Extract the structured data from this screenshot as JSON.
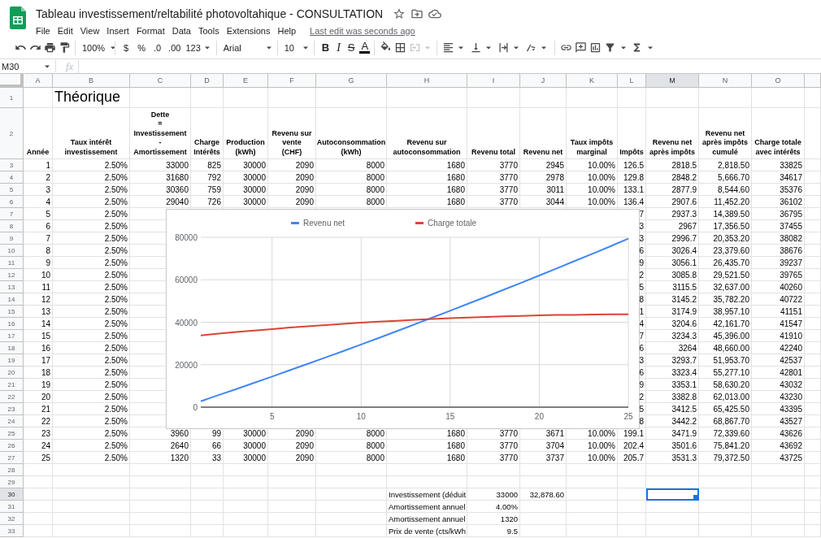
{
  "app": {
    "title": "Tableau investissement/reltabilité photovoltahique - CONSULTATION",
    "menus": [
      "File",
      "Edit",
      "View",
      "Insert",
      "Format",
      "Data",
      "Tools",
      "Extensions",
      "Help"
    ],
    "last_edit": "Last edit was seconds ago"
  },
  "toolbar": {
    "zoom": "100%",
    "currency": "$",
    "percent": "%",
    "decrease_decimals": ".0",
    "increase_decimals": ".00",
    "number_format": "123",
    "font": "Arial",
    "font_size": "10",
    "bold": "B",
    "italic": "I",
    "strikethrough": "S",
    "text_color": "A"
  },
  "formula_bar": {
    "name_box": "M30",
    "fx": "fx"
  },
  "sheet": {
    "columns": [
      {
        "label": "A",
        "selected": false
      },
      {
        "label": "B",
        "selected": false
      },
      {
        "label": "C",
        "selected": false
      },
      {
        "label": "D",
        "selected": false
      },
      {
        "label": "E",
        "selected": false
      },
      {
        "label": "F",
        "selected": false
      },
      {
        "label": "G",
        "selected": false
      },
      {
        "label": "H",
        "selected": false
      },
      {
        "label": "I",
        "selected": false
      },
      {
        "label": "J",
        "selected": false
      },
      {
        "label": "K",
        "selected": false
      },
      {
        "label": "L",
        "selected": false
      },
      {
        "label": "M",
        "selected": true
      },
      {
        "label": "N",
        "selected": false
      },
      {
        "label": "O",
        "selected": false
      }
    ],
    "rows": [
      {
        "header": "1",
        "selected": false,
        "kind": "title",
        "cells": [
          null,
          "Théorique"
        ]
      },
      {
        "header": "2",
        "selected": false,
        "kind": "header",
        "cells": [
          "Année",
          "Taux intérêt\ninvestissement",
          "Dette\n=\nInvestissement\n-\nAmortissement",
          "Charge\nIntérêts",
          "Production\n(kWh)",
          "Revenu sur\nvente\n(CHF)",
          "Autoconsommation\n(kWh)",
          "Revenu sur\nautoconsommation",
          "Revenu total",
          "Revenu net",
          "Taux impôts\nmarginal",
          "Impôts",
          "Revenu net\naprès impôts",
          "Revenu net\naprès impôts\ncumulé",
          "Charge totale\navec intérêts"
        ]
      },
      {
        "header": "3",
        "selected": false,
        "kind": "data",
        "cells": [
          "1",
          "2.50%",
          "33000",
          "825",
          "30000",
          "2090",
          "8000",
          "1680",
          "3770",
          "2945",
          "10.00%",
          "126.5",
          "2818.5",
          "2,818.50",
          "33825"
        ]
      },
      {
        "header": "4",
        "selected": false,
        "kind": "data",
        "cells": [
          "2",
          "2.50%",
          "31680",
          "792",
          "30000",
          "2090",
          "8000",
          "1680",
          "3770",
          "2978",
          "10.00%",
          "129.8",
          "2848.2",
          "5,666.70",
          "34617"
        ]
      },
      {
        "header": "5",
        "selected": false,
        "kind": "data",
        "cells": [
          "3",
          "2.50%",
          "30360",
          "759",
          "30000",
          "2090",
          "8000",
          "1680",
          "3770",
          "3011",
          "10.00%",
          "133.1",
          "2877.9",
          "8,544.60",
          "35376"
        ]
      },
      {
        "header": "6",
        "selected": false,
        "kind": "data",
        "cells": [
          "4",
          "2.50%",
          "29040",
          "726",
          "30000",
          "2090",
          "8000",
          "1680",
          "3770",
          "3044",
          "10.00%",
          "136.4",
          "2907.6",
          "11,452.20",
          "36102"
        ]
      },
      {
        "header": "7",
        "selected": false,
        "kind": "data",
        "cells": [
          "5",
          "2.50%",
          null,
          null,
          null,
          null,
          null,
          null,
          null,
          null,
          null,
          "7",
          "2937.3",
          "14,389.50",
          "36795"
        ]
      },
      {
        "header": "8",
        "selected": false,
        "kind": "data",
        "cells": [
          "6",
          "2.50%",
          null,
          null,
          null,
          null,
          null,
          null,
          null,
          null,
          null,
          "3",
          "2967",
          "17,356.50",
          "37455"
        ]
      },
      {
        "header": "9",
        "selected": false,
        "kind": "data",
        "cells": [
          "7",
          "2.50%",
          null,
          null,
          null,
          null,
          null,
          null,
          null,
          null,
          null,
          "3",
          "2996.7",
          "20,353.20",
          "38082"
        ]
      },
      {
        "header": "10",
        "selected": false,
        "kind": "data",
        "cells": [
          "8",
          "2.50%",
          null,
          null,
          null,
          null,
          null,
          null,
          null,
          null,
          null,
          "6",
          "3026.4",
          "23,379.60",
          "38676"
        ]
      },
      {
        "header": "11",
        "selected": false,
        "kind": "data",
        "cells": [
          "9",
          "2.50%",
          null,
          null,
          null,
          null,
          null,
          null,
          null,
          null,
          null,
          "9",
          "3056.1",
          "26,435.70",
          "39237"
        ]
      },
      {
        "header": "12",
        "selected": false,
        "kind": "data",
        "cells": [
          "10",
          "2.50%",
          null,
          null,
          null,
          null,
          null,
          null,
          null,
          null,
          null,
          "2",
          "3085.8",
          "29,521.50",
          "39765"
        ]
      },
      {
        "header": "13",
        "selected": false,
        "kind": "data",
        "cells": [
          "11",
          "2.50%",
          null,
          null,
          null,
          null,
          null,
          null,
          null,
          null,
          null,
          "5",
          "3115.5",
          "32,637.00",
          "40260"
        ]
      },
      {
        "header": "14",
        "selected": false,
        "kind": "data",
        "cells": [
          "12",
          "2.50%",
          null,
          null,
          null,
          null,
          null,
          null,
          null,
          null,
          null,
          "8",
          "3145.2",
          "35,782.20",
          "40722"
        ]
      },
      {
        "header": "15",
        "selected": false,
        "kind": "data",
        "cells": [
          "13",
          "2.50%",
          null,
          null,
          null,
          null,
          null,
          null,
          null,
          null,
          null,
          "1",
          "3174.9",
          "38,957.10",
          "41151"
        ]
      },
      {
        "header": "16",
        "selected": false,
        "kind": "data",
        "cells": [
          "14",
          "2.50%",
          null,
          null,
          null,
          null,
          null,
          null,
          null,
          null,
          null,
          "4",
          "3204.6",
          "42,161.70",
          "41547"
        ]
      },
      {
        "header": "17",
        "selected": false,
        "kind": "data",
        "cells": [
          "15",
          "2.50%",
          null,
          null,
          null,
          null,
          null,
          null,
          null,
          null,
          null,
          "7",
          "3234.3",
          "45,396.00",
          "41910"
        ]
      },
      {
        "header": "18",
        "selected": false,
        "kind": "data",
        "cells": [
          "16",
          "2.50%",
          null,
          null,
          null,
          null,
          null,
          null,
          null,
          null,
          null,
          "6",
          "3264",
          "48,660.00",
          "42240"
        ]
      },
      {
        "header": "19",
        "selected": false,
        "kind": "data",
        "cells": [
          "17",
          "2.50%",
          null,
          null,
          null,
          null,
          null,
          null,
          null,
          null,
          null,
          "3",
          "3293.7",
          "51,953.70",
          "42537"
        ]
      },
      {
        "header": "20",
        "selected": false,
        "kind": "data",
        "cells": [
          "18",
          "2.50%",
          null,
          null,
          null,
          null,
          null,
          null,
          null,
          null,
          null,
          "6",
          "3323.4",
          "55,277.10",
          "42801"
        ]
      },
      {
        "header": "21",
        "selected": false,
        "kind": "data",
        "cells": [
          "19",
          "2.50%",
          null,
          null,
          null,
          null,
          null,
          null,
          null,
          null,
          null,
          "9",
          "3353.1",
          "58,630.20",
          "43032"
        ]
      },
      {
        "header": "22",
        "selected": false,
        "kind": "data",
        "cells": [
          "20",
          "2.50%",
          null,
          null,
          null,
          null,
          null,
          null,
          null,
          null,
          null,
          "2",
          "3382.8",
          "62,013.00",
          "43230"
        ]
      },
      {
        "header": "23",
        "selected": false,
        "kind": "data",
        "cells": [
          "21",
          "2.50%",
          null,
          null,
          null,
          null,
          null,
          null,
          null,
          null,
          null,
          "5",
          "3412.5",
          "65,425.50",
          "43395"
        ]
      },
      {
        "header": "24",
        "selected": false,
        "kind": "data",
        "cells": [
          "22",
          "2.50%",
          null,
          null,
          null,
          null,
          null,
          null,
          null,
          null,
          null,
          "8",
          "3442.2",
          "68,867.70",
          "43527"
        ]
      },
      {
        "header": "25",
        "selected": false,
        "kind": "data",
        "cells": [
          "23",
          "2.50%",
          "3960",
          "99",
          "30000",
          "2090",
          "8000",
          "1680",
          "3770",
          "3671",
          "10.00%",
          "199.1",
          "3471.9",
          "72,339.60",
          "43626"
        ]
      },
      {
        "header": "26",
        "selected": false,
        "kind": "data",
        "cells": [
          "24",
          "2.50%",
          "2640",
          "66",
          "30000",
          "2090",
          "8000",
          "1680",
          "3770",
          "3704",
          "10.00%",
          "202.4",
          "3501.6",
          "75,841.20",
          "43692"
        ]
      },
      {
        "header": "27",
        "selected": false,
        "kind": "data",
        "cells": [
          "25",
          "2.50%",
          "1320",
          "33",
          "30000",
          "2090",
          "8000",
          "1680",
          "3770",
          "3737",
          "10.00%",
          "205.7",
          "3531.3",
          "79,372.50",
          "43725"
        ]
      },
      {
        "header": "28",
        "selected": false,
        "kind": "data"
      },
      {
        "header": "29",
        "selected": false,
        "kind": "data"
      },
      {
        "header": "30",
        "selected": true,
        "kind": "note",
        "cells": [
          null,
          null,
          null,
          null,
          null,
          null,
          null,
          "Investissement (déduit",
          "33000",
          "32,878.60"
        ]
      },
      {
        "header": "31",
        "selected": false,
        "kind": "note",
        "cells": [
          null,
          null,
          null,
          null,
          null,
          null,
          null,
          "Amortissement annuel",
          "4.00%"
        ]
      },
      {
        "header": "32",
        "selected": false,
        "kind": "note",
        "cells": [
          null,
          null,
          null,
          null,
          null,
          null,
          null,
          "Amortissement annuel",
          "1320"
        ]
      },
      {
        "header": "33",
        "selected": false,
        "kind": "note",
        "cells": [
          null,
          null,
          null,
          null,
          null,
          null,
          null,
          "Prix de vente (cts/kWh",
          "9.5"
        ]
      }
    ],
    "chart": {
      "chart_data": {
        "type": "line",
        "x": [
          1,
          2,
          3,
          4,
          5,
          6,
          7,
          8,
          9,
          10,
          11,
          12,
          13,
          14,
          15,
          16,
          17,
          18,
          19,
          20,
          21,
          22,
          23,
          24,
          25
        ],
        "series": [
          {
            "name": "Revenu net",
            "color": "#4285f4",
            "values": [
              2800,
              5700,
              8500,
              11500,
              14400,
              17400,
              20400,
              23400,
              26400,
              29500,
              32600,
              35800,
              39000,
              42200,
              45400,
              48700,
              52000,
              55300,
              58600,
              62000,
              65400,
              68900,
              72300,
              75800,
              79400
            ]
          },
          {
            "name": "Charge totale",
            "color": "#db4437",
            "values": [
              33800,
              34600,
              35400,
              36100,
              36800,
              37500,
              38100,
              38700,
              39200,
              39800,
              40300,
              40700,
              41200,
              41500,
              41900,
              42200,
              42500,
              42800,
              43000,
              43200,
              43400,
              43500,
              43600,
              43700,
              43700
            ]
          }
        ],
        "grid": true,
        "legend": "top",
        "xlim": [
          1,
          25
        ],
        "ylim": [
          0,
          80000
        ],
        "xticks": [
          5,
          10,
          15,
          20,
          25
        ],
        "yticks": [
          0,
          20000,
          40000,
          60000,
          80000
        ]
      }
    }
  }
}
